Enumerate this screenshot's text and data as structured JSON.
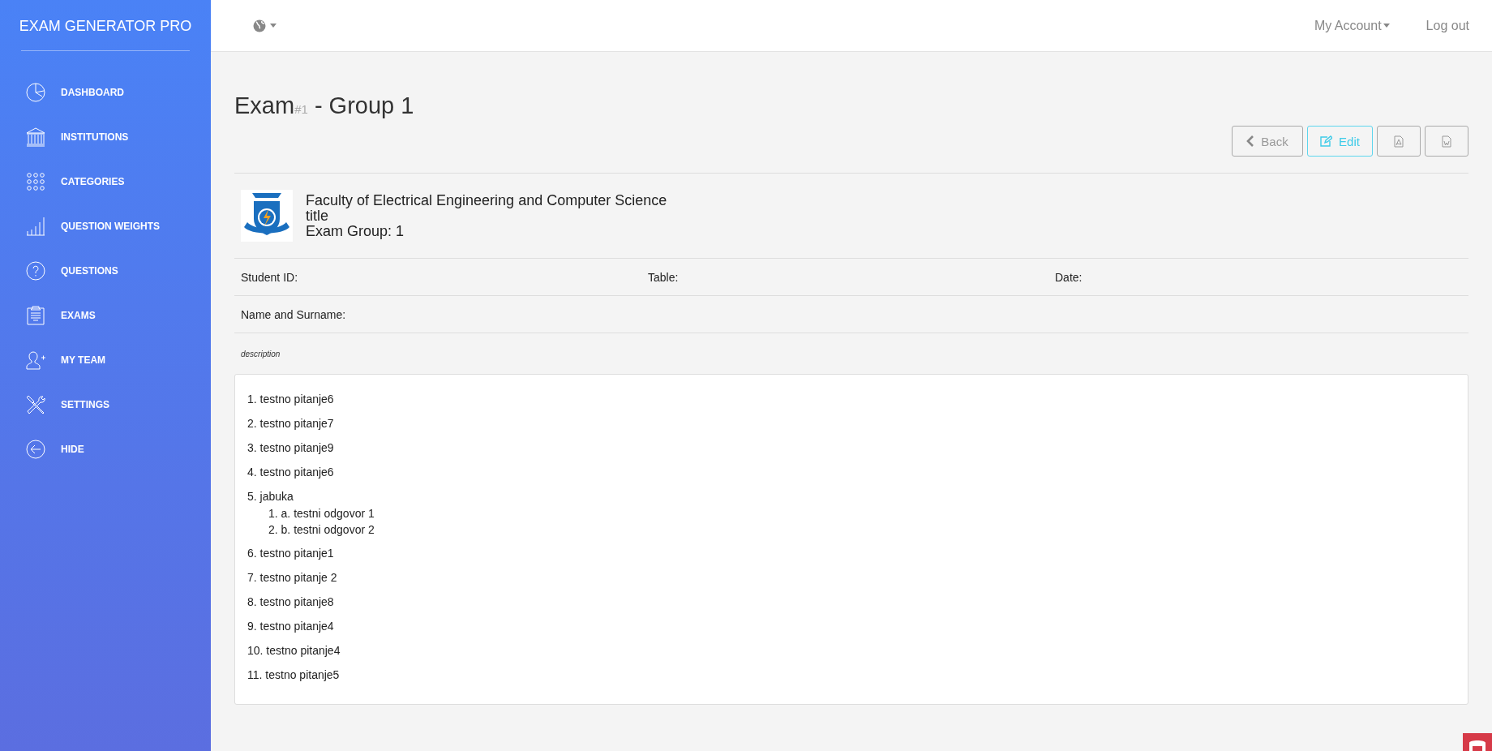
{
  "sidebar": {
    "brand": "EXAM GENERATOR PRO",
    "items": [
      {
        "label": "DASHBOARD",
        "kind": "pie"
      },
      {
        "label": "INSTITUTIONS",
        "kind": "building"
      },
      {
        "label": "CATEGORIES",
        "kind": "dots"
      },
      {
        "label": "QUESTION WEIGHTS",
        "kind": "bars"
      },
      {
        "label": "QUESTIONS",
        "kind": "question"
      },
      {
        "label": "EXAMS",
        "kind": "clipboard"
      },
      {
        "label": "MY TEAM",
        "kind": "team"
      },
      {
        "label": "SETTINGS",
        "kind": "tools"
      },
      {
        "label": "HIDE",
        "kind": "hide"
      }
    ]
  },
  "topbar": {
    "account": "My Account",
    "logout": "Log out"
  },
  "page": {
    "title": "Exam",
    "title_number": "#1",
    "title_rest": "- Group 1"
  },
  "buttons": [
    {
      "kind": "back",
      "label": "Back"
    },
    {
      "kind": "edit",
      "label": "Edit"
    },
    {
      "kind": "pdf"
    },
    {
      "kind": "word"
    }
  ],
  "header": {
    "institution": "Faculty of Electrical Engineering and Computer Science",
    "subtitle": "title",
    "group": "Exam Group: 1"
  },
  "fields": [
    {
      "label": "Student ID:"
    },
    {
      "label": "Table:"
    },
    {
      "label": "Date:"
    },
    {
      "label": "Name and Surname:"
    }
  ],
  "description": "description",
  "questions": [
    {
      "number": "1.",
      "text": "testno pitanje6"
    },
    {
      "number": "2.",
      "text": "testno pitanje7"
    },
    {
      "number": "3.",
      "text": "testno pitanje9"
    },
    {
      "number": "4.",
      "text": "testno pitanje6"
    },
    {
      "number": "5.",
      "text": "jabuka",
      "answers": [
        {
          "number": "1.",
          "text": "a. testni odgovor 1"
        },
        {
          "number": "2.",
          "text": "b. testni odgovor 2"
        }
      ]
    },
    {
      "number": "6.",
      "text": "testno pitanje1"
    },
    {
      "number": "7.",
      "text": "testno pitanje 2"
    },
    {
      "number": "8.",
      "text": "testno pitanje8"
    },
    {
      "number": "9.",
      "text": "testno pitanje4"
    },
    {
      "number": "10.",
      "text": "testno pitanje4"
    },
    {
      "number": "11.",
      "text": "testno pitanje5"
    }
  ]
}
